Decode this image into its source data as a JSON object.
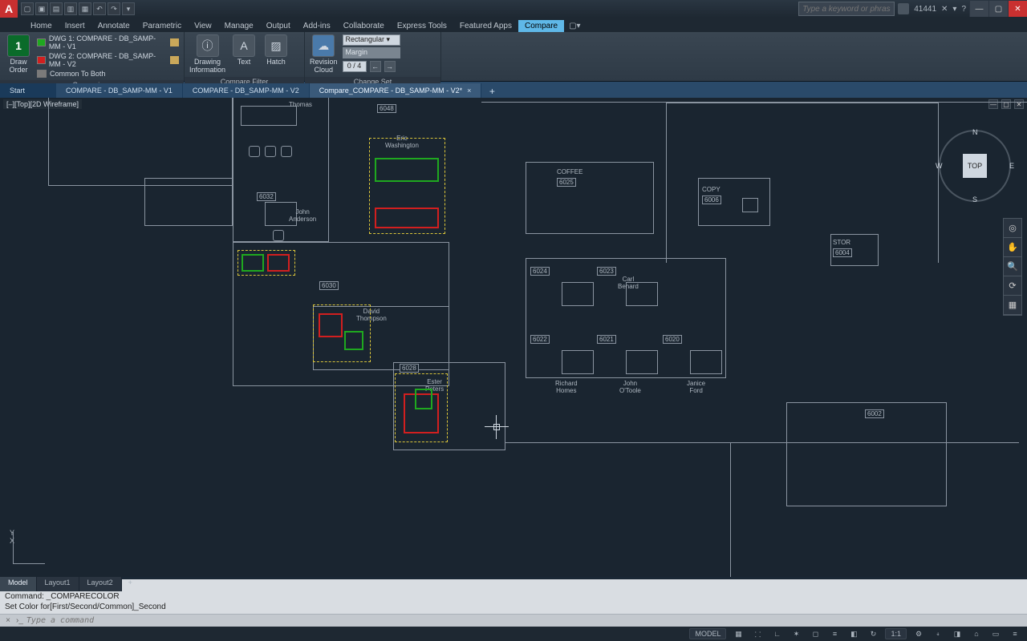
{
  "title_search_placeholder": "Type a keyword or phrase",
  "user_id": "41441",
  "ribbon_tabs": [
    "Home",
    "Insert",
    "Annotate",
    "Parametric",
    "View",
    "Manage",
    "Output",
    "Add-ins",
    "Collaborate",
    "Express Tools",
    "Featured Apps",
    "Compare"
  ],
  "ribbon_active_tab": "Compare",
  "panels": {
    "comparison": {
      "title": "Comparison",
      "draw_order": "Draw\nOrder",
      "draw_order_badge": "1",
      "dwg1": "DWG 1:  COMPARE - DB_SAMP-MM - V1",
      "dwg2": "DWG 2:  COMPARE - DB_SAMP-MM - V2",
      "common": "Common To Both"
    },
    "compare_filter": {
      "title": "Compare Filter",
      "drawing_info": "Drawing\nInformation",
      "text": "Text",
      "hatch": "Hatch"
    },
    "change_set": {
      "title": "Change Set",
      "revision_cloud": "Revision\nCloud",
      "shape": "Rectangular",
      "margin_label": "Margin",
      "counter": "0  /  4"
    }
  },
  "doc_tabs": {
    "start": "Start",
    "t1": "COMPARE - DB_SAMP-MM - V1",
    "t2": "COMPARE - DB_SAMP-MM - V2",
    "t3": "Compare_COMPARE - DB_SAMP-MM - V2*"
  },
  "viewport_label": "[–][Top][2D Wireframe]",
  "viewcube": {
    "face": "TOP",
    "n": "N",
    "s": "S",
    "e": "E",
    "w": "W"
  },
  "rooms": {
    "r6048": "6048",
    "r6032": "6032",
    "r6030": "6030",
    "r6028": "6028",
    "r6024": "6024",
    "r6023": "6023",
    "r6022": "6022",
    "r6021": "6021",
    "r6020": "6020",
    "r6006": "6006",
    "r6004": "6004",
    "r6002": "6002",
    "r6025": "6025",
    "coffee": "COFFEE",
    "copy": "COPY",
    "stor": "STOR"
  },
  "people": {
    "thomas": "Thomas",
    "washington": "Eric\nWashington",
    "anderson": "John\nAnderson",
    "thompson": "David\nThompson",
    "peters": "Ester\nPeters",
    "benard": "Carl\nBenard",
    "homes": "Richard\nHomes",
    "otoole": "John\nO'Toole",
    "ford": "Janice\nFord"
  },
  "ucs": {
    "x": "X",
    "y": "Y"
  },
  "cmd": {
    "l1": "Command:",
    "l2": "Command: _COMPARECOLOR",
    "l3": "Set Color for[First/Second/Common]_Second",
    "placeholder": "Type a command"
  },
  "layout_tabs": {
    "model": "Model",
    "l1": "Layout1",
    "l2": "Layout2"
  },
  "status": {
    "model": "MODEL",
    "scale": "1:1",
    "menu": "≡"
  }
}
